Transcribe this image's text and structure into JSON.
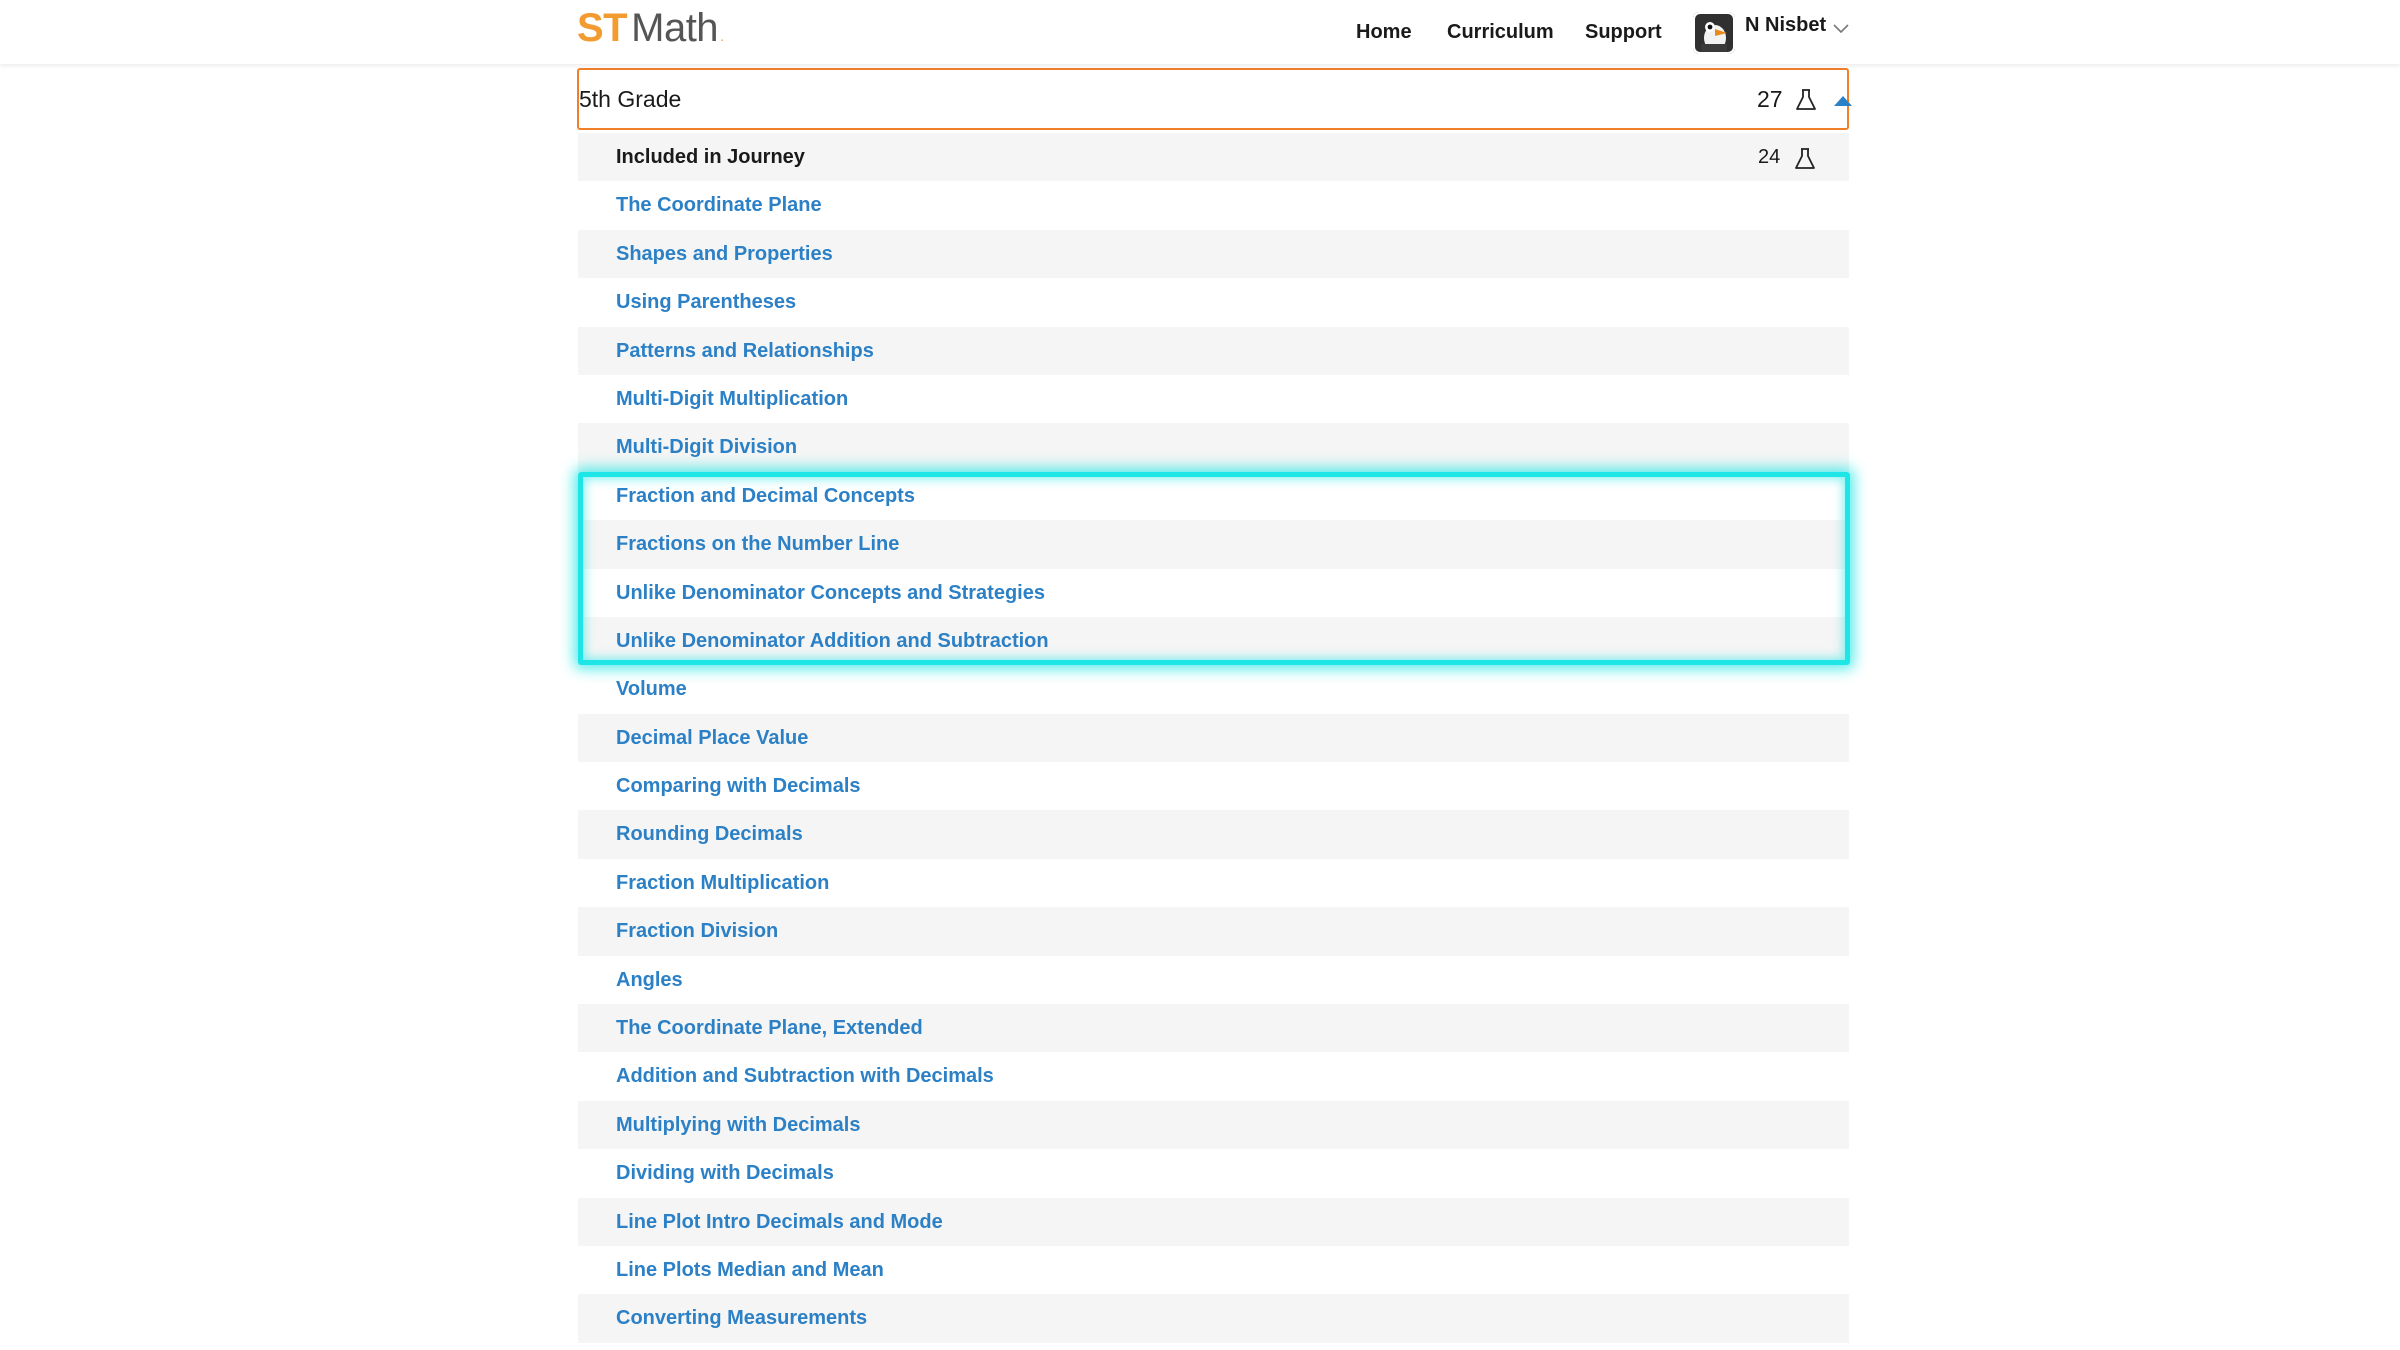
{
  "header": {
    "logo_st": "ST",
    "logo_math": "Math",
    "logo_dot": ".",
    "nav": [
      "Home",
      "Curriculum",
      "Support"
    ],
    "user_name": "N Nisbet",
    "icons": {
      "avatar": "penguin-avatar",
      "user_menu": "chevron-down-icon"
    }
  },
  "grade": {
    "title": "5th Grade",
    "count": "27",
    "icons": {
      "flask": "flask-icon",
      "toggle": "caret-up-icon"
    },
    "accent_color": "#f07f2a"
  },
  "journey": {
    "label": "Included in Journey",
    "count": "24"
  },
  "topics": [
    "The Coordinate Plane",
    "Shapes and Properties",
    "Using Parentheses",
    "Patterns and Relationships",
    "Multi-Digit Multiplication",
    "Multi-Digit Division",
    "Fraction and Decimal Concepts",
    "Fractions on the Number Line",
    "Unlike Denominator Concepts and Strategies",
    "Unlike Denominator Addition and Subtraction",
    "Volume",
    "Decimal Place Value",
    "Comparing with Decimals",
    "Rounding Decimals",
    "Fraction Multiplication",
    "Fraction Division",
    "Angles",
    "The Coordinate Plane, Extended",
    "Addition and Subtraction with Decimals",
    "Multiplying with Decimals",
    "Dividing with Decimals",
    "Line Plot Intro Decimals and Mode",
    "Line Plots Median and Mean",
    "Converting Measurements"
  ],
  "colors": {
    "link": "#2c80c6",
    "highlight": "#1ee6e6",
    "logo_orange": "#f29b30"
  }
}
